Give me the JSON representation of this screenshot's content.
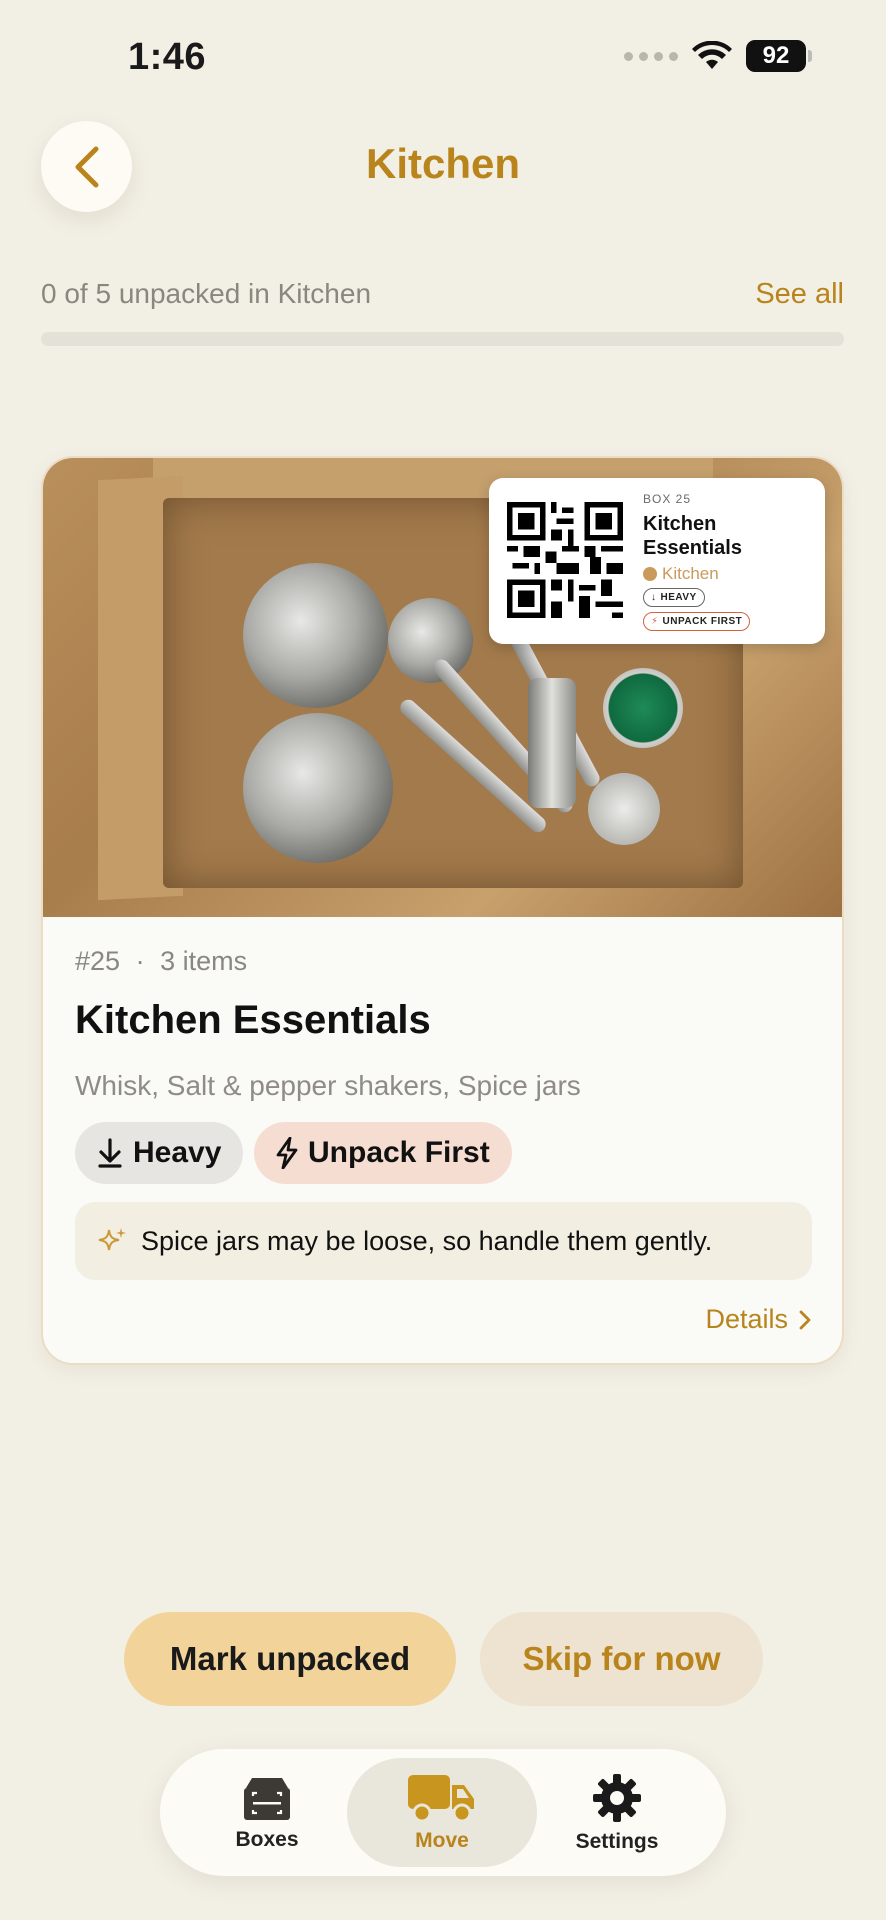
{
  "status_bar": {
    "time": "1:46",
    "battery": "92"
  },
  "header": {
    "title": "Kitchen"
  },
  "progress": {
    "label": "0 of 5 unpacked in Kitchen",
    "see_all": "See all",
    "fraction": 0
  },
  "box": {
    "label": {
      "box_number": "BOX 25",
      "title": "Kitchen Essentials",
      "room": "Kitchen",
      "tags": [
        "HEAVY",
        "UNPACK FIRST"
      ]
    },
    "number": "#25",
    "separator": "·",
    "item_count": "3 items",
    "title": "Kitchen Essentials",
    "contents": "Whisk, Salt & pepper shakers, Spice jars",
    "tags": [
      {
        "label": "Heavy",
        "icon": "download-arrow-icon"
      },
      {
        "label": "Unpack First",
        "icon": "lightning-icon"
      }
    ],
    "note": "Spice jars may be loose, so handle them gently.",
    "details_link": "Details"
  },
  "actions": {
    "primary": "Mark unpacked",
    "secondary": "Skip for now"
  },
  "tabbar": {
    "items": [
      {
        "label": "Boxes",
        "icon": "box-scan-icon"
      },
      {
        "label": "Move",
        "icon": "truck-icon",
        "active": true
      },
      {
        "label": "Settings",
        "icon": "gear-icon"
      }
    ]
  },
  "colors": {
    "accent": "#b8841b",
    "background": "#f2efe5",
    "primary_button": "#f2d49a",
    "unpack_first_pill": "#f5ddd2"
  }
}
